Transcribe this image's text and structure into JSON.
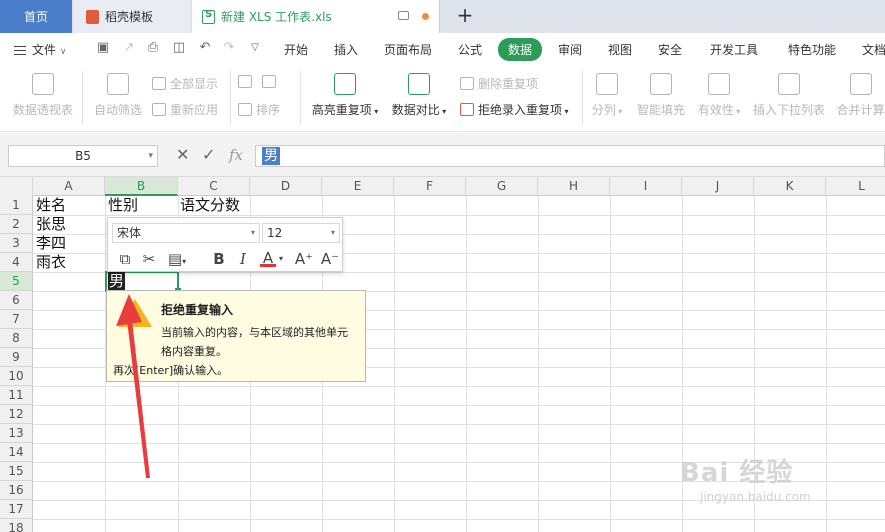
{
  "tabs": {
    "home": "首页",
    "template": "稻壳模板",
    "file": "新建 XLS 工作表.xls"
  },
  "menu": {
    "file": "文件",
    "items": [
      "开始",
      "插入",
      "页面布局",
      "公式",
      "数据",
      "审阅",
      "视图",
      "安全",
      "开发工具",
      "特色功能",
      "文档"
    ],
    "active": "数据"
  },
  "ribbon": {
    "pivot": "数据透视表",
    "autofilter": "自动筛选",
    "show_all": "全部显示",
    "reapply": "重新应用",
    "sort": "排序",
    "highlight_dup": "高亮重复项",
    "compare": "数据对比",
    "remove_dup": "删除重复项",
    "reject_dup": "拒绝录入重复项",
    "split": "分列",
    "smart_fill": "智能填充",
    "validity": "有效性",
    "insert_dropdown": "插入下拉列表",
    "merge_calc": "合并计算"
  },
  "formula_bar": {
    "name_box": "B5",
    "fx": "fx",
    "value": "男"
  },
  "grid": {
    "columns": [
      "A",
      "B",
      "C",
      "D",
      "E",
      "F",
      "G",
      "H",
      "I",
      "J",
      "K",
      "L"
    ],
    "rows": [
      "1",
      "2",
      "3",
      "4",
      "5",
      "6",
      "7",
      "8",
      "9",
      "10",
      "11",
      "12",
      "13",
      "14",
      "15",
      "16",
      "17",
      "18"
    ],
    "selected_col": "B",
    "selected_row": "5",
    "cells": {
      "A1": "姓名",
      "B1": "性别",
      "C1": "语文分数",
      "A2": "张思",
      "A3": "李四",
      "A4": "雨衣",
      "B5": "男"
    }
  },
  "mini_toolbar": {
    "font": "宋体",
    "size": "12",
    "bold": "B",
    "italic": "I",
    "font_color": "A",
    "grow": "A⁺",
    "shrink": "A⁻"
  },
  "popup": {
    "title": "拒绝重复输入",
    "line1": "当前输入的内容，与本区域的其他单元",
    "line2": "格内容重复。",
    "line3": "再次[Enter]确认输入。"
  },
  "watermark": {
    "main": "Bai 经验",
    "sub": "jingyan.baidu.com"
  },
  "colors": {
    "accent": "#2c9c58",
    "home_tab": "#4a7ecb",
    "arrow": "#e83d3d",
    "warning": "#f6b51d"
  }
}
